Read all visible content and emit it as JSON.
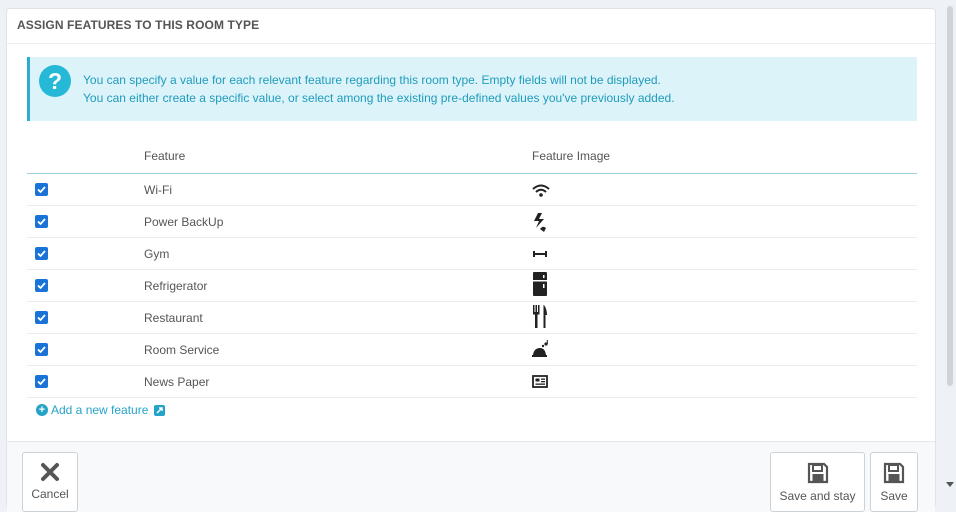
{
  "panel": {
    "title": "ASSIGN FEATURES TO THIS ROOM TYPE"
  },
  "alert": {
    "icon": "question-icon",
    "line1": "You can specify a value for each relevant feature regarding this room type. Empty fields will not be displayed.",
    "line2": "You can either create a specific value, or select among the existing pre-defined values you've previously added."
  },
  "table": {
    "headers": {
      "feature": "Feature",
      "image": "Feature Image"
    },
    "rows": [
      {
        "name": "Wi-Fi",
        "checked": true,
        "icon": "wifi-icon"
      },
      {
        "name": "Power BackUp",
        "checked": true,
        "icon": "power-backup-icon"
      },
      {
        "name": "Gym",
        "checked": true,
        "icon": "dumbbell-icon"
      },
      {
        "name": "Refrigerator",
        "checked": true,
        "icon": "refrigerator-icon"
      },
      {
        "name": "Restaurant",
        "checked": true,
        "icon": "fork-knife-icon"
      },
      {
        "name": "Room Service",
        "checked": true,
        "icon": "service-bell-icon"
      },
      {
        "name": "News Paper",
        "checked": true,
        "icon": "newspaper-icon"
      }
    ]
  },
  "add_feature": {
    "label": "Add a new feature"
  },
  "footer": {
    "cancel_label": "Cancel",
    "save_stay_label": "Save and stay",
    "save_label": "Save"
  },
  "colors": {
    "accent": "#25b9d7",
    "link": "#25a3c6",
    "checkbox": "#1a73d9",
    "alert_bg": "#dcf4f9"
  }
}
